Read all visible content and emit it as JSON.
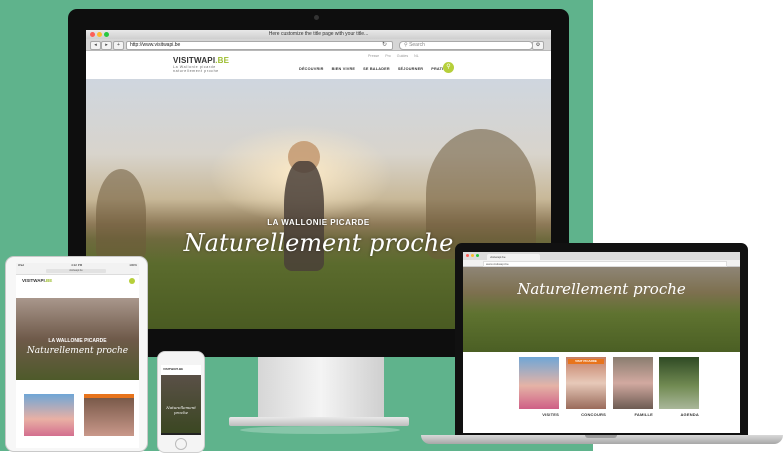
{
  "imac": {
    "window_title": "Here customize the title page with your title...",
    "url": "http://www.visitwapi.be",
    "search_placeholder": "Search",
    "logo": {
      "main": "VISITWAPI",
      "accent": ".BE",
      "line1": "La Wallonie picarde",
      "line2": "naturellement proche"
    },
    "nav": [
      "DÉCOUVRIR",
      "BIEN VIVRE",
      "SE BALADER",
      "SÉJOURNER",
      "PRATIQUE"
    ],
    "utility": [
      "Presse",
      "Pro",
      "Guides",
      "NL"
    ],
    "hero_overline": "LA WALLONIE PICARDE",
    "hero_script": "Naturellement proche"
  },
  "ipad": {
    "status_left": "iPad",
    "status_time": "4:22 PM",
    "status_right": "100%",
    "url": "visitwapi.be",
    "logo": {
      "main": "VISITWAPI",
      "accent": ".BE"
    },
    "hero_overline": "LA WALLONIE PICARDE",
    "hero_script": "Naturellement proche"
  },
  "iphone": {
    "logo": "VISITWAPI.BE",
    "hero_script": "Naturellement proche"
  },
  "macbook": {
    "tab_title": "visitwapi.be",
    "url": "www.visitwapi.be",
    "hero_script": "Naturellement proche",
    "concours_band": "VISIT PICARDE",
    "tiles": [
      "VISITES",
      "CONCOURS",
      "FAMILLE",
      "AGENDA"
    ]
  },
  "colors": {
    "background_green": "#5fb38c",
    "brand_lime": "#b6cf3a",
    "brand_orange": "#e8741c"
  }
}
